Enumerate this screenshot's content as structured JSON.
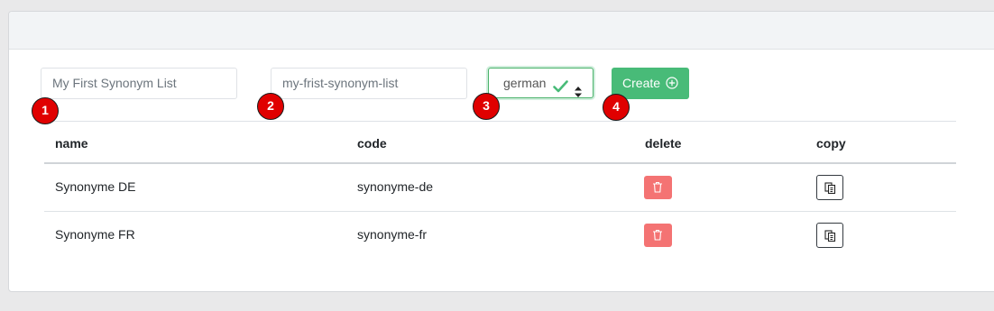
{
  "form": {
    "name_placeholder": "My First Synonym List",
    "code_placeholder": "my-frist-synonym-list",
    "language_selected": "german",
    "create_label": "Create"
  },
  "badges": [
    "1",
    "2",
    "3",
    "4"
  ],
  "table": {
    "columns": [
      "name",
      "code",
      "delete",
      "copy"
    ],
    "rows": [
      {
        "name": "Synonyme DE",
        "code": "synonyme-de"
      },
      {
        "name": "Synonyme FR",
        "code": "synonyme-fr"
      }
    ]
  },
  "colors": {
    "accent_green": "#48bb78",
    "delete_red": "#f47373",
    "badge_red": "#e00000"
  }
}
